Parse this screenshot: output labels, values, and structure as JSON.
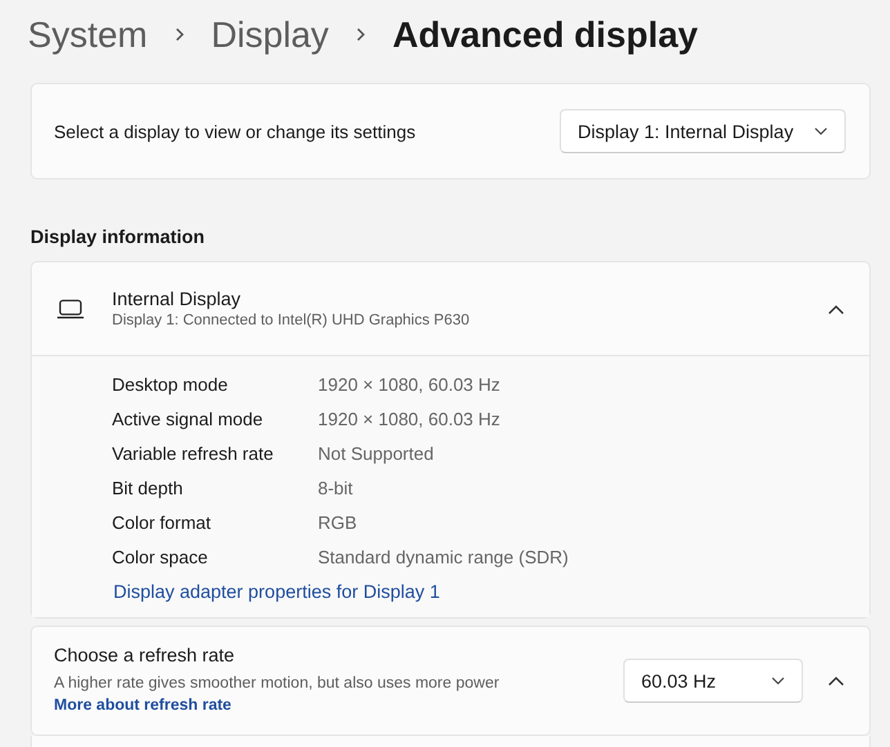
{
  "breadcrumb": [
    {
      "label": "System",
      "current": false
    },
    {
      "label": "Display",
      "current": false
    },
    {
      "label": "Advanced display",
      "current": true
    }
  ],
  "display_select": {
    "label": "Select a display to view or change its settings",
    "value": "Display 1: Internal Display"
  },
  "section_title": "Display information",
  "display_info": {
    "title": "Internal Display",
    "subtitle": "Display 1: Connected to Intel(R) UHD Graphics P630",
    "expanded": true,
    "rows": [
      {
        "name": "Desktop mode",
        "value": "1920 × 1080, 60.03 Hz"
      },
      {
        "name": "Active signal mode",
        "value": "1920 × 1080, 60.03 Hz"
      },
      {
        "name": "Variable refresh rate",
        "value": "Not Supported"
      },
      {
        "name": "Bit depth",
        "value": "8-bit"
      },
      {
        "name": "Color format",
        "value": "RGB"
      },
      {
        "name": "Color space",
        "value": "Standard dynamic range (SDR)"
      }
    ],
    "link": "Display adapter properties for Display 1"
  },
  "refresh_rate": {
    "title": "Choose a refresh rate",
    "description": "A higher rate gives smoother motion, but also uses more power",
    "link": "More about refresh rate",
    "value": "60.03 Hz",
    "expanded": true
  }
}
